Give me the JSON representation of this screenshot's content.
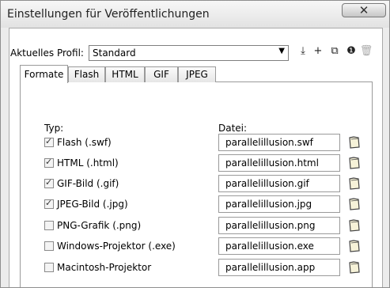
{
  "window": {
    "title": "Einstellungen für Veröffentlichungen",
    "close_glyph": "✕"
  },
  "profile": {
    "label": "Aktuelles Profil:",
    "value": "Standard",
    "toolbar": [
      {
        "name": "import-export-icon",
        "glyph": "⤓"
      },
      {
        "name": "add-profile-icon",
        "glyph": "+"
      },
      {
        "name": "duplicate-profile-icon",
        "glyph": "⧉"
      },
      {
        "name": "profile-properties-icon",
        "glyph": "❶"
      },
      {
        "name": "delete-profile-icon",
        "glyph": "🗑"
      }
    ]
  },
  "tabs": [
    "Formate",
    "Flash",
    "HTML",
    "GIF",
    "JPEG"
  ],
  "columns": {
    "type": "Typ:",
    "file": "Datei:"
  },
  "rows": [
    {
      "label": "Flash  (.swf)",
      "file": "parallelillusion.swf",
      "checked": true
    },
    {
      "label": "HTML  (.html)",
      "file": "parallelillusion.html",
      "checked": true
    },
    {
      "label": "GIF-Bild  (.gif)",
      "file": "parallelillusion.gif",
      "checked": true
    },
    {
      "label": "JPEG-Bild  (.jpg)",
      "file": "parallelillusion.jpg",
      "checked": true
    },
    {
      "label": "PNG-Grafik  (.png)",
      "file": "parallelillusion.png",
      "checked": false
    },
    {
      "label": "Windows-Projektor  (.exe)",
      "file": "parallelillusion.exe",
      "checked": false
    },
    {
      "label": "Macintosh-Projektor",
      "file": "parallelillusion.app",
      "checked": false
    }
  ]
}
